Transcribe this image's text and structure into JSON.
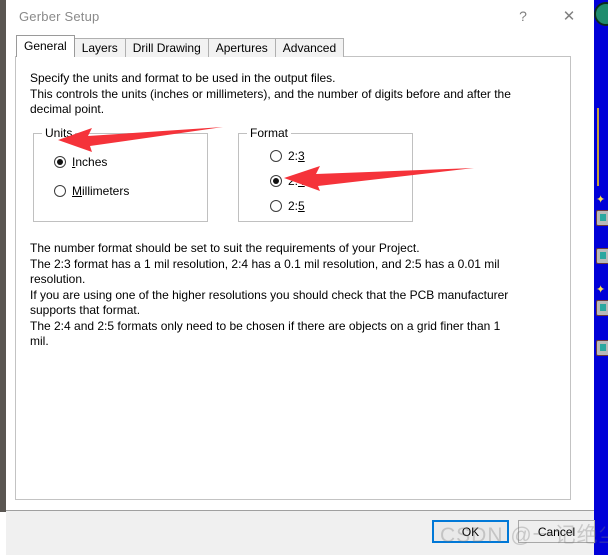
{
  "window": {
    "title": "Gerber Setup",
    "help_label": "?",
    "close_label": "✕"
  },
  "tabs": [
    {
      "label": "General",
      "active": true
    },
    {
      "label": "Layers",
      "active": false
    },
    {
      "label": "Drill Drawing",
      "active": false
    },
    {
      "label": "Apertures",
      "active": false
    },
    {
      "label": "Advanced",
      "active": false
    }
  ],
  "description_top": [
    "Specify the units and format to be used in the output files.",
    "This controls the units (inches or millimeters), and the number of digits before and after the",
    "decimal point."
  ],
  "units_group": {
    "title": "Units",
    "options": [
      {
        "label": "Inches",
        "accel": "I",
        "rest": "nches",
        "checked": true
      },
      {
        "label": "Millimeters",
        "accel": "M",
        "rest": "illimeters",
        "checked": false
      }
    ]
  },
  "format_group": {
    "title": "Format",
    "options": [
      {
        "prefix": "2:",
        "accel": "3",
        "label": "2:3",
        "checked": false
      },
      {
        "prefix": "2:",
        "accel": "4",
        "label": "2:4",
        "checked": true
      },
      {
        "prefix": "2:",
        "accel": "5",
        "label": "2:5",
        "checked": false
      }
    ]
  },
  "description_bottom": [
    "The number format should be set to suit the requirements of your Project.",
    "The 2:3 format has a 1 mil resolution, 2:4 has a 0.1 mil resolution, and 2:5 has a 0.01 mil",
    "resolution.",
    "If you are using one of the higher resolutions you should check that the PCB manufacturer",
    "supports that format.",
    "The 2:4 and 2:5 formats only need to be chosen if there are objects on a grid finer than 1",
    "mil."
  ],
  "footer": {
    "ok_label": "OK",
    "cancel_label": "Cancel"
  },
  "annotations": {
    "arrow_color": "#f5333a",
    "units_arrow_target": "Units",
    "format_arrow_target": "2:4"
  },
  "watermark": {
    "text": "CSDN @一记绝尘"
  },
  "colors": {
    "focus_blue": "#0078d7",
    "desktop_blue": "#0000d8",
    "panel_white": "#ffffff",
    "footer_gray": "#f0f0f0"
  }
}
